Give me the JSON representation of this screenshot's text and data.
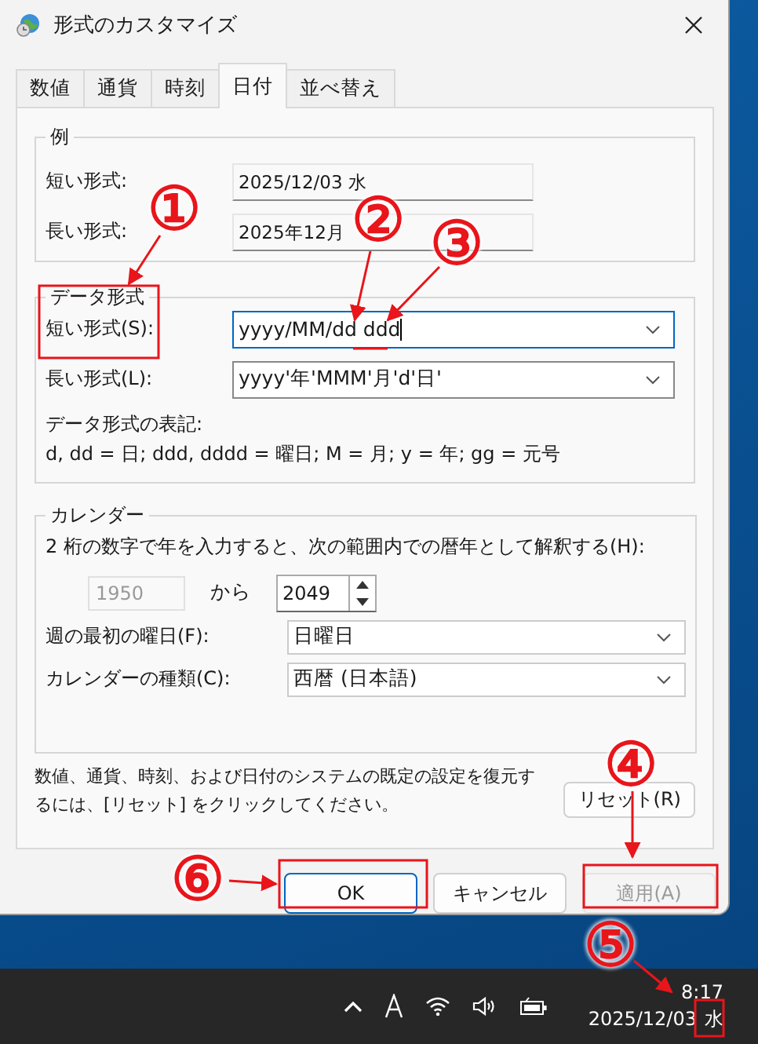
{
  "window": {
    "title": "形式のカスタマイズ"
  },
  "tabs": [
    {
      "label": "数値",
      "selected": false
    },
    {
      "label": "通貨",
      "selected": false
    },
    {
      "label": "時刻",
      "selected": false
    },
    {
      "label": "日付",
      "selected": true
    },
    {
      "label": "並べ替え",
      "selected": false
    }
  ],
  "example": {
    "title": "例",
    "rows": [
      {
        "label": "短い形式:",
        "value": "2025/12/03 水"
      },
      {
        "label": "長い形式:",
        "value": "2025年12月"
      }
    ]
  },
  "date_format": {
    "title": "データ形式",
    "fields": [
      {
        "label": "短い形式(S):",
        "value": "yyyy/MM/dd ddd",
        "focused": true
      },
      {
        "label": "長い形式(L):",
        "value": "yyyy'年'MMM'月'd'日'",
        "focused": false
      }
    ],
    "notation_title": "データ形式の表記:",
    "notation": "d, dd = 日;  ddd, dddd = 曜日; M = 月; y = 年; gg = 元号"
  },
  "calendar": {
    "title": "カレンダー",
    "two_digit_text": "2 桁の数字で年を入力すると、次の範囲内での暦年として解釈する(H):",
    "from_year": "1950",
    "from_label": "から",
    "to_year": "2049",
    "selects": [
      {
        "label": "週の最初の曜日(F):",
        "value": "日曜日"
      },
      {
        "label": "カレンダーの種類(C):",
        "value": "西暦 (日本語)"
      }
    ]
  },
  "reset_text": "数値、通貨、時刻、および日付のシステムの既定の設定を復元するには、[リセット] をクリックしてください。",
  "reset_button": "リセット(R)",
  "buttons": [
    {
      "label": "OK",
      "kind": "default",
      "disabled": false
    },
    {
      "label": "キャンセル",
      "kind": "normal",
      "disabled": false
    },
    {
      "label": "適用(A)",
      "kind": "normal",
      "disabled": true
    }
  ],
  "taskbar": {
    "time": "8:17",
    "date": "2025/12/03",
    "weekday": "水"
  },
  "annotations": [
    {
      "label": "①"
    },
    {
      "label": "②"
    },
    {
      "label": "③"
    },
    {
      "label": "④"
    },
    {
      "label": "⑤"
    },
    {
      "label": "⑥"
    }
  ]
}
